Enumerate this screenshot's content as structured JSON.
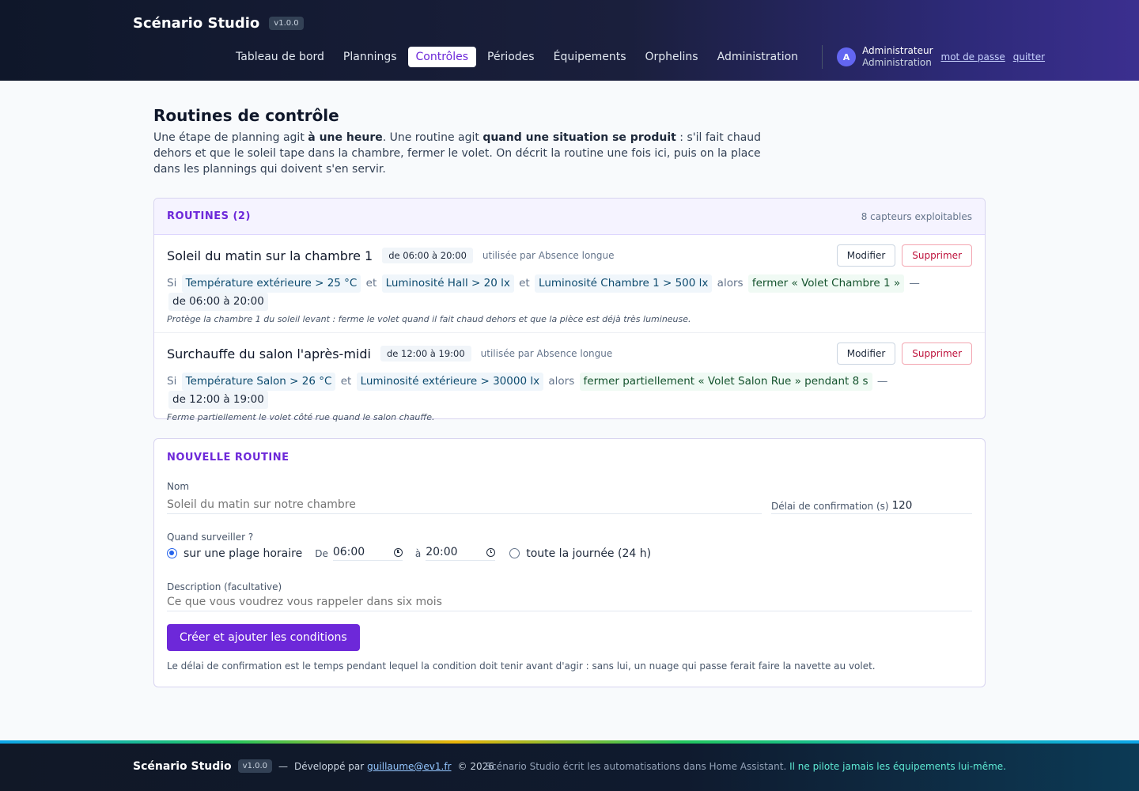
{
  "header": {
    "brand": "Scénario Studio",
    "version": "v1.0.0",
    "nav": [
      {
        "label": "Tableau de bord"
      },
      {
        "label": "Plannings"
      },
      {
        "label": "Contrôles",
        "active": true
      },
      {
        "label": "Périodes"
      },
      {
        "label": "Équipements"
      },
      {
        "label": "Orphelins"
      },
      {
        "label": "Administration"
      }
    ],
    "user": {
      "initial": "A",
      "name": "Administrateur",
      "role": "Administration",
      "password_link": "mot de passe",
      "logout_link": "quitter"
    }
  },
  "page": {
    "title": "Routines de contrôle",
    "intro_p1": "Une étape de planning agit ",
    "intro_b1": "à une heure",
    "intro_p2": ". Une routine agit ",
    "intro_b2": "quand une situation se produit",
    "intro_p3": " : s'il fait chaud dehors et que le soleil tape dans la chambre, fermer le volet. On décrit la routine une fois ici, puis on la place dans les plannings qui doivent s'en servir."
  },
  "routines": {
    "title": "ROUTINES (2)",
    "meta": "8 capteurs exploitables",
    "edit_label": "Modifier",
    "delete_label": "Supprimer",
    "word_if": "Si",
    "word_and": "et",
    "word_then": "alors",
    "dash": "—",
    "items": [
      {
        "name": "Soleil du matin sur la chambre 1",
        "range": "de 06:00 à 20:00",
        "usage": "utilisée par Absence longue",
        "conditions": [
          "Température extérieure > 25 °C",
          "Luminosité Hall > 20 lx",
          "Luminosité Chambre 1 > 500 lx"
        ],
        "action": "fermer « Volet Chambre 1 »",
        "time": "de 06:00 à 20:00",
        "description": "Protège la chambre 1 du soleil levant : ferme le volet quand il fait chaud dehors et que la pièce est déjà très lumineuse."
      },
      {
        "name": "Surchauffe du salon l'après-midi",
        "range": "de 12:00 à 19:00",
        "usage": "utilisée par Absence longue",
        "conditions": [
          "Température Salon > 26 °C",
          "Luminosité extérieure > 30000 lx"
        ],
        "action": "fermer partiellement « Volet Salon Rue » pendant 8 s",
        "time": "de 12:00 à 19:00",
        "description": "Ferme partiellement le volet côté rue quand le salon chauffe."
      }
    ]
  },
  "new_routine": {
    "title": "NOUVELLE ROUTINE",
    "name_label": "Nom",
    "name_placeholder": "Soleil du matin sur notre chambre",
    "delay_label": "Délai de confirmation (s)",
    "delay_value": "120",
    "when_label": "Quand surveiller ?",
    "option_range": "sur une plage horaire",
    "from_label": "De",
    "from_value": "06:00",
    "to_label": "à",
    "to_value": "20:00",
    "option_all_day": "toute la journée (24 h)",
    "desc_label": "Description (facultative)",
    "desc_placeholder": "Ce que vous voudrez vous rappeler dans six mois",
    "submit_label": "Créer et ajouter les conditions",
    "footnote": "Le délai de confirmation est le temps pendant lequel la condition doit tenir avant d'agir : sans lui, un nuage qui passe ferait faire la navette au volet."
  },
  "footer": {
    "brand": "Scénario Studio",
    "version": "v1.0.0",
    "dash": "—",
    "dev_by": "Développé par",
    "email": "guillaume@ev1.fr",
    "copyright": "© 2026",
    "note": "Scénario Studio écrit les automatisations dans Home Assistant. ",
    "note_highlight": "Il ne pilote jamais les équipements lui-même."
  }
}
